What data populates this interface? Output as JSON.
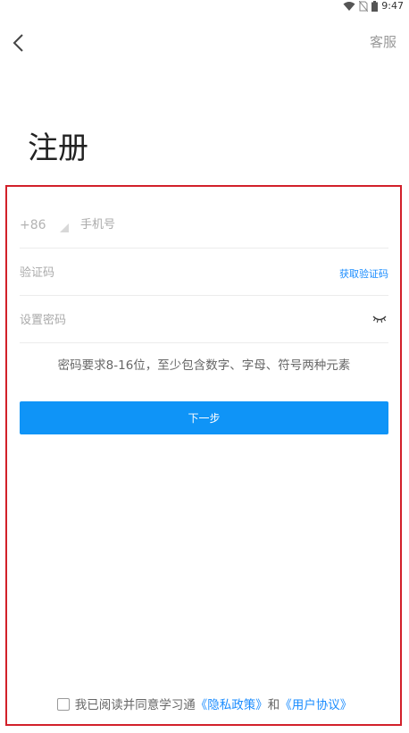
{
  "status_bar": {
    "time": "9:47"
  },
  "header": {
    "service_label": "客服"
  },
  "page": {
    "title": "注册"
  },
  "form": {
    "country_code": "+86",
    "phone_placeholder": "手机号",
    "code_placeholder": "验证码",
    "get_code_label": "获取验证码",
    "password_placeholder": "设置密码",
    "password_hint": "密码要求8-16位，至少包含数字、字母、符号两种元素",
    "next_label": "下一步"
  },
  "agreement": {
    "prefix": "我已阅读并同意学习通",
    "privacy_label": "《隐私政策》",
    "and": "和",
    "user_agreement_label": "《用户协议》"
  },
  "colors": {
    "accent": "#0f94f7",
    "link": "#1a8cff",
    "frame": "#d2202a"
  }
}
